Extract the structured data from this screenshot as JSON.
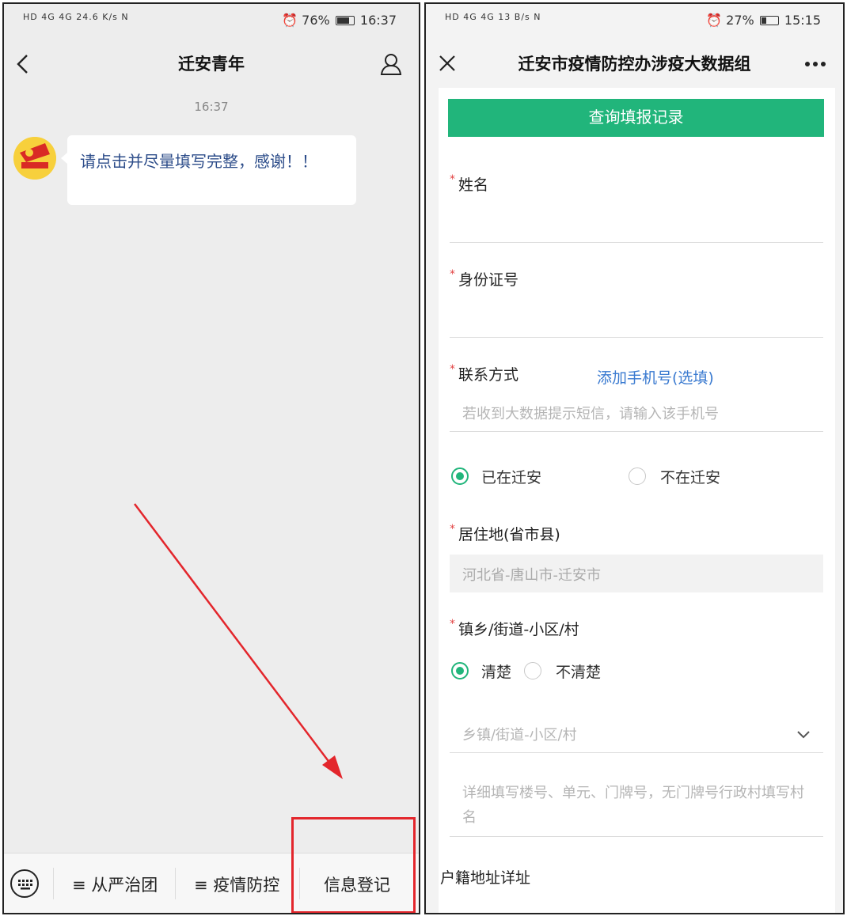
{
  "left": {
    "status": {
      "left": "HD 4G 4G 24.6 K/s N",
      "right_pct": "76%",
      "time": "16:37"
    },
    "nav": {
      "title": "迁安青年"
    },
    "chat": {
      "timestamp": "16:37",
      "message": "请点击并尽量填写完整，感谢！！"
    },
    "menu": {
      "item1": "≡ 从严治团",
      "item2": "≡ 疫情防控",
      "item3": "信息登记"
    }
  },
  "right": {
    "status": {
      "left": "HD 4G 4G 13 B/s N",
      "right_pct": "27%",
      "time": "15:15"
    },
    "nav": {
      "title": "迁安市疫情防控办涉疫大数据组"
    },
    "form": {
      "query_button": "查询填报记录",
      "name_label": "姓名",
      "id_label": "身份证号",
      "contact_label": "联系方式",
      "add_phone_link": "添加手机号(选填)",
      "phone_placeholder": "若收到大数据提示短信，请输入该手机号",
      "in_qianan": "已在迁安",
      "not_in_qianan": "不在迁安",
      "residence_label": "居住地(省市县)",
      "residence_value": "河北省-唐山市-迁安市",
      "town_label": "镇乡/街道-小区/村",
      "clear": "清楚",
      "unclear": "不清楚",
      "town_placeholder": "乡镇/街道-小区/村",
      "detail_placeholder": "详细填写楼号、单元、门牌号，无门牌号行政村填写村名",
      "household_label": "户籍地址详址"
    }
  }
}
